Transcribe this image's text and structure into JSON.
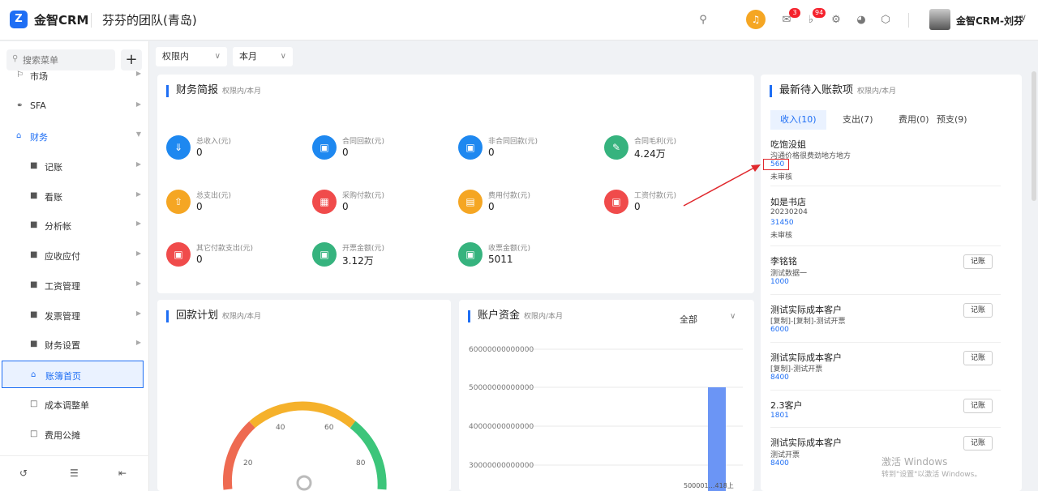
{
  "header": {
    "logo_letter": "Z",
    "brand": "金智CRM",
    "team": "芬芬的团队(青岛)",
    "mail_badge": "3",
    "bell_badge": "94",
    "user_name": "金智CRM-刘芬"
  },
  "sidebar": {
    "search_placeholder": "搜索菜单",
    "items": [
      {
        "label": "市场"
      },
      {
        "label": "SFA"
      },
      {
        "label": "财务"
      },
      {
        "label": "记账"
      },
      {
        "label": "看账"
      },
      {
        "label": "分析帐"
      },
      {
        "label": "应收应付"
      },
      {
        "label": "工资管理"
      },
      {
        "label": "发票管理"
      },
      {
        "label": "财务设置"
      },
      {
        "label": "账簿首页"
      },
      {
        "label": "成本调整单"
      },
      {
        "label": "费用公摊"
      }
    ]
  },
  "filters": {
    "scope": "权限内",
    "period": "本月"
  },
  "finance": {
    "title": "财务简报",
    "subtitle": "权限内/本月",
    "stats": [
      {
        "label": "总收入(元)",
        "value": "0",
        "color": "#1e88f0"
      },
      {
        "label": "合同回款(元)",
        "value": "0",
        "color": "#1e88f0"
      },
      {
        "label": "非合同回款(元)",
        "value": "0",
        "color": "#1e88f0"
      },
      {
        "label": "合同毛利(元)",
        "value": "4.24万",
        "color": "#36b37e"
      },
      {
        "label": "总支出(元)",
        "value": "0",
        "color": "#f5a623"
      },
      {
        "label": "采购付款(元)",
        "value": "0",
        "color": "#f04b4b"
      },
      {
        "label": "费用付款(元)",
        "value": "0",
        "color": "#f5a623"
      },
      {
        "label": "工资付款(元)",
        "value": "0",
        "color": "#f04b4b"
      },
      {
        "label": "其它付款支出(元)",
        "value": "0",
        "color": "#f04b4b"
      },
      {
        "label": "开票金额(元)",
        "value": "3.12万",
        "color": "#36b37e"
      },
      {
        "label": "收票金额(元)",
        "value": "5011",
        "color": "#36b37e"
      }
    ]
  },
  "payback": {
    "title": "回款计划",
    "subtitle": "权限内/本月",
    "gauge_ticks": [
      "20",
      "40",
      "60",
      "80"
    ]
  },
  "account": {
    "title": "账户资金",
    "subtitle": "权限内/本月",
    "filter": "全部",
    "axis_labels": [
      "60000000000000",
      "50000000000000",
      "40000000000000",
      "30000000000000"
    ],
    "bar_label": "500001…418上"
  },
  "pending": {
    "title": "最新待入账款项",
    "subtitle": "权限内/本月",
    "tabs": [
      "收入(10)",
      "支出(7)",
      "费用(0)",
      "预支(9)"
    ],
    "record_label": "记账",
    "items": [
      {
        "name": "吃饱没姐",
        "desc": "沟通价格很费劲地方地方",
        "amount": "560",
        "status": "未审核"
      },
      {
        "name": "如是书店",
        "desc": "20230204",
        "amount": "31450",
        "status": "未审核"
      },
      {
        "name": "李铭铭",
        "desc": "测试数据一",
        "amount": "1000",
        "status": ""
      },
      {
        "name": "测试实际成本客户",
        "desc": "[复制]-[复制]-测试开票",
        "amount": "6000",
        "status": ""
      },
      {
        "name": "测试实际成本客户",
        "desc": "[复制]-测试开票",
        "amount": "8400",
        "status": ""
      },
      {
        "name": "2.3客户",
        "desc": "",
        "amount": "1801",
        "status": ""
      },
      {
        "name": "测试实际成本客户",
        "desc": "测试开票",
        "amount": "8400",
        "status": ""
      }
    ]
  },
  "watermark": {
    "line1": "激活 Windows",
    "line2": "转到\"设置\"以激活 Windows。"
  }
}
